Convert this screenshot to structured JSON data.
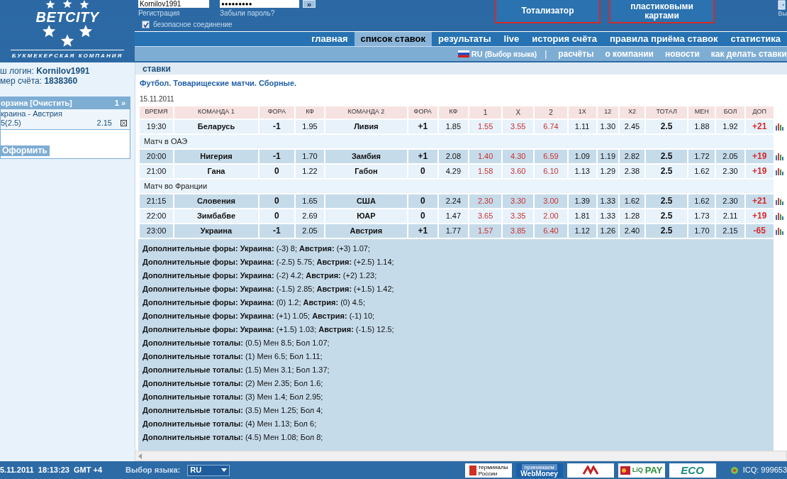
{
  "header": {
    "logo": {
      "name": "BETCITY",
      "tagline": "БУКМЕКЕРСКАЯ КОМПАНИЯ"
    },
    "login": {
      "username": "Kornilov1991",
      "password": "●●●●●●●●●",
      "submit": "»",
      "register_link": "Регистрация",
      "forgot_link": "Забыли пароль?",
      "secure": {
        "label": "безопасное соединение",
        "checked": true
      }
    },
    "promo_buttons": [
      "Тотализатор",
      "пластиковыми картами"
    ],
    "exit_label": "Вы"
  },
  "nav": [
    {
      "label": "главная",
      "selected": false
    },
    {
      "label": "список ставок",
      "selected": true
    },
    {
      "label": "результаты",
      "selected": false
    },
    {
      "label": "live",
      "selected": false
    },
    {
      "label": "история счёта",
      "selected": false
    },
    {
      "label": "правила приёма ставок",
      "selected": false
    },
    {
      "label": "статистика",
      "selected": false
    }
  ],
  "subnav": {
    "language": "RU",
    "language_hint": "(Выбор языка)",
    "separator": "|",
    "links": [
      "расчёты",
      "о компании",
      "новости",
      "как делать ставки"
    ]
  },
  "sidebar": {
    "login_line": "ш логин: **Kornilov1991**",
    "account_line": "мер счёта: **1838360**",
    "basket": {
      "title": "орзина",
      "clear_link": "[Очистить]",
      "count": "1 »",
      "items": [
        {
          "event": "краина - Австрия",
          "bet": "5(2.5)",
          "odds": "2.15"
        }
      ],
      "submit": "Оформить"
    }
  },
  "main": {
    "section": "ставки",
    "title": "Футбол. Товарищеские матчи. Сборные.",
    "date": "15.11.2011",
    "table": {
      "columns": [
        "ВРЕМЯ",
        "КОМАНДА 1",
        "ФОРА",
        "КФ",
        "КОМАНДА 2",
        "ФОРА",
        "КФ",
        "1",
        "X",
        "2",
        "1X",
        "12",
        "X2",
        "ТОТАЛ",
        "МЕН",
        "БОЛ",
        "ДОП"
      ],
      "rows": [
        {
          "kind": "match",
          "cells": [
            "19:30",
            "Беларусь",
            "-1",
            "1.95",
            "Ливия",
            "+1",
            "1.85",
            "1.55",
            "3.55",
            "6.74",
            "1.11",
            "1.30",
            "2.45",
            "2.5",
            "1.88",
            "1.92",
            "+21"
          ]
        },
        {
          "kind": "group",
          "title": "Матч в ОАЭ"
        },
        {
          "kind": "match",
          "cells": [
            "20:00",
            "Нигерия",
            "-1",
            "1.70",
            "Замбия",
            "+1",
            "2.08",
            "1.40",
            "4.30",
            "6.59",
            "1.09",
            "1.19",
            "2.82",
            "2.5",
            "1.72",
            "2.05",
            "+19"
          ]
        },
        {
          "kind": "match",
          "cells": [
            "21:00",
            "Гана",
            "0",
            "1.22",
            "Габон",
            "0",
            "4.29",
            "1.58",
            "3.60",
            "6.10",
            "1.13",
            "1.29",
            "2.38",
            "2.5",
            "1.62",
            "2.30",
            "+19"
          ]
        },
        {
          "kind": "group",
          "title": "Матч во Франции"
        },
        {
          "kind": "match",
          "cells": [
            "21:15",
            "Словения",
            "0",
            "1.65",
            "США",
            "0",
            "2.24",
            "2.30",
            "3.30",
            "3.00",
            "1.39",
            "1.33",
            "1.62",
            "2.5",
            "1.62",
            "2.30",
            "+21"
          ]
        },
        {
          "kind": "match",
          "cells": [
            "22:00",
            "Зимбабве",
            "0",
            "2.69",
            "ЮАР",
            "0",
            "1.47",
            "3.65",
            "3.35",
            "2.00",
            "1.81",
            "1.33",
            "1.28",
            "2.5",
            "1.73",
            "2.11",
            "+19"
          ]
        },
        {
          "kind": "match",
          "cells": [
            "23:00",
            "Украина",
            "-1",
            "2.05",
            "Австрия",
            "+1",
            "1.77",
            "1.57",
            "3.85",
            "6.40",
            "1.12",
            "1.26",
            "2.40",
            "2.5",
            "1.70",
            "2.15",
            "-65"
          ]
        }
      ]
    },
    "extras": [
      "**Дополнительные форы: Украина:** (-3) 8; **Австрия:** (+3) 1.07;",
      "**Дополнительные форы: Украина:** (-2.5) 5.75; **Австрия:** (+2.5) 1.14;",
      "**Дополнительные форы: Украина:** (-2) 4.2; **Австрия:** (+2) 1.23;",
      "**Дополнительные форы: Украина:** (-1.5) 2.85; **Австрия:** (+1.5) 1.42;",
      "**Дополнительные форы: Украина:** (0) 1.2; **Австрия:** (0) 4.5;",
      "**Дополнительные форы: Украина:** (+1) 1.05; **Австрия:** (-1) 10;",
      "**Дополнительные форы: Украина:** (+1.5) 1.03; **Австрия:** (-1.5) 12.5;",
      "**Дополнительные тоталы:** (0.5) Мен 8.5; Бол 1.07;",
      "**Дополнительные тоталы:** (1) Мен 6.5; Бол 1.11;",
      "**Дополнительные тоталы:** (1.5) Мен 3.1; Бол 1.37;",
      "**Дополнительные тоталы:** (2) Мен 2.35; Бол 1.6;",
      "**Дополнительные тоталы:** (3) Мен 1.4; Бол 2.95;",
      "**Дополнительные тоталы:** (3.5) Мен 1.25; Бол 4;",
      "**Дополнительные тоталы:** (4) Мен 1.13; Бол 6;",
      "**Дополнительные тоталы:** (4.5) Мен 1.08; Бол 8;"
    ]
  },
  "footer": {
    "datetime": "5.11.2011  18:13:23  GMT +4",
    "language_label": "Выбор языка:",
    "language": "RU",
    "banners": [
      {
        "kind": "terminals",
        "lines": [
          "терминалы",
          "России"
        ]
      },
      {
        "kind": "webmoney",
        "lines": [
          "принимаем",
          "WebMoney"
        ]
      },
      {
        "kind": "plain"
      },
      {
        "kind": "liqpay",
        "lines": [
          "LiQ",
          "PAY"
        ]
      },
      {
        "kind": "eco",
        "lines": [
          "ECO"
        ]
      }
    ],
    "icq": "ICQ: 999653"
  }
}
